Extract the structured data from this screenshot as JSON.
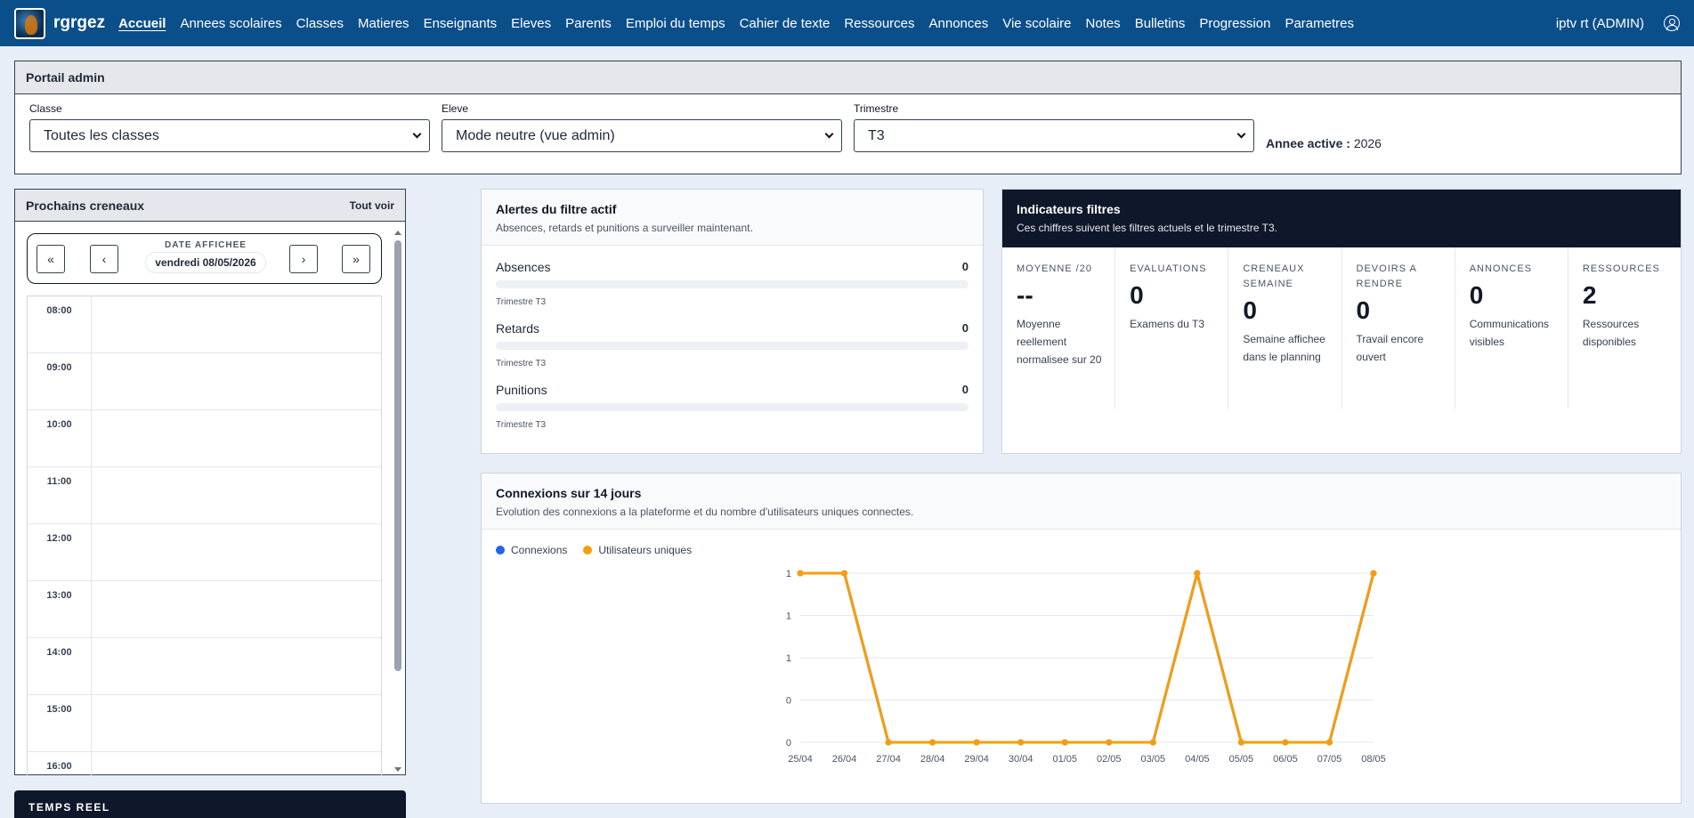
{
  "nav": {
    "brand": "rgrgez",
    "links": [
      "Accueil",
      "Annees scolaires",
      "Classes",
      "Matieres",
      "Enseignants",
      "Eleves",
      "Parents",
      "Emploi du temps",
      "Cahier de texte",
      "Ressources",
      "Annonces",
      "Vie scolaire",
      "Notes",
      "Bulletins",
      "Progression",
      "Parametres"
    ],
    "active": "Accueil",
    "user": "iptv rt (ADMIN)"
  },
  "portal": {
    "title": "Portail admin",
    "classe_label": "Classe",
    "classe_value": "Toutes les classes",
    "eleve_label": "Eleve",
    "eleve_value": "Mode neutre (vue admin)",
    "trimestre_label": "Trimestre",
    "trimestre_value": "T3",
    "annee_label": "Annee active :",
    "annee_value": "2026"
  },
  "schedule": {
    "title": "Prochains creneaux",
    "see_all": "Tout voir",
    "first": "«",
    "prev": "‹",
    "next": "›",
    "last": "»",
    "date_label": "DATE AFFICHEE",
    "date_value": "vendredi 08/05/2026",
    "hours": [
      "08:00",
      "09:00",
      "10:00",
      "11:00",
      "12:00",
      "13:00",
      "14:00",
      "15:00",
      "16:00"
    ]
  },
  "realtime": {
    "title": "TEMPS REEL"
  },
  "alerts": {
    "title": "Alertes du filtre actif",
    "subtitle": "Absences, retards et punitions a surveiller maintenant.",
    "items": [
      {
        "label": "Absences",
        "count": "0",
        "meta": "Trimestre T3"
      },
      {
        "label": "Retards",
        "count": "0",
        "meta": "Trimestre T3"
      },
      {
        "label": "Punitions",
        "count": "0",
        "meta": "Trimestre T3"
      }
    ]
  },
  "indicators": {
    "title": "Indicateurs filtres",
    "subtitle": "Ces chiffres suivent les filtres actuels et le trimestre T3.",
    "stats": [
      {
        "label": "Moyenne /20",
        "value": "--",
        "desc": "Moyenne reellement normalisee sur 20"
      },
      {
        "label": "Evaluations",
        "value": "0",
        "desc": "Examens du T3"
      },
      {
        "label": "Creneaux semaine",
        "value": "0",
        "desc": "Semaine affichee dans le planning"
      },
      {
        "label": "Devoirs a rendre",
        "value": "0",
        "desc": "Travail encore ouvert"
      },
      {
        "label": "Annonces",
        "value": "0",
        "desc": "Communications visibles"
      },
      {
        "label": "Ressources",
        "value": "2",
        "desc": "Ressources disponibles"
      }
    ]
  },
  "connections": {
    "title": "Connexions sur 14 jours",
    "subtitle": "Evolution des connexions a la plateforme et du nombre d'utilisateurs uniques connectes.",
    "colors": {
      "connexions": "#2563eb",
      "uniques": "#f59e0b"
    }
  },
  "chart_data": {
    "type": "line",
    "x": [
      "25/04",
      "26/04",
      "27/04",
      "28/04",
      "29/04",
      "30/04",
      "01/05",
      "02/05",
      "03/05",
      "04/05",
      "05/05",
      "06/05",
      "07/05",
      "08/05"
    ],
    "series": [
      {
        "name": "Connexions",
        "values": [
          1,
          1,
          0,
          0,
          0,
          0,
          0,
          0,
          0,
          1,
          0,
          0,
          0,
          1
        ]
      },
      {
        "name": "Utilisateurs uniques",
        "values": [
          1,
          1,
          0,
          0,
          0,
          0,
          0,
          0,
          0,
          1,
          0,
          0,
          0,
          1
        ]
      }
    ],
    "y_ticks": [
      "0",
      "0",
      "1",
      "1",
      "1"
    ],
    "ylim": [
      0,
      1
    ],
    "grid": true,
    "legend": "top-left"
  }
}
